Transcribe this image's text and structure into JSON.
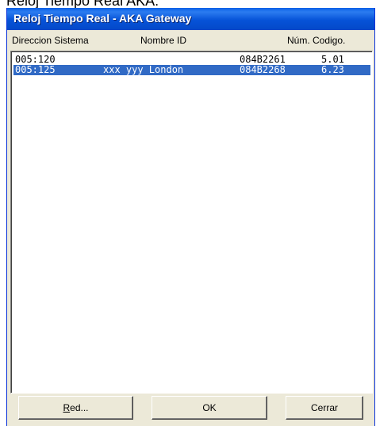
{
  "background_caption": "Reloj Tiempo Real AKA:",
  "window": {
    "title": "Reloj Tiempo Real - AKA Gateway"
  },
  "columns": {
    "address": "Direccion Sistema",
    "name": "Nombre ID",
    "number_code": "Núm. Codigo."
  },
  "rows": [
    {
      "address": "005:120",
      "name": "",
      "number": "084B2261",
      "code": "5.01",
      "selected": false
    },
    {
      "address": "005:125",
      "name": "xxx yyy London",
      "number": "084B2268",
      "code": "6.23",
      "selected": true
    }
  ],
  "buttons": {
    "red_mnemonic": "R",
    "red_rest": "ed...",
    "ok": "OK",
    "cerrar": "Cerrar"
  },
  "colors": {
    "titlebar": "#0653d8",
    "selection": "#316ac5",
    "dialog_face": "#ece9d8"
  }
}
